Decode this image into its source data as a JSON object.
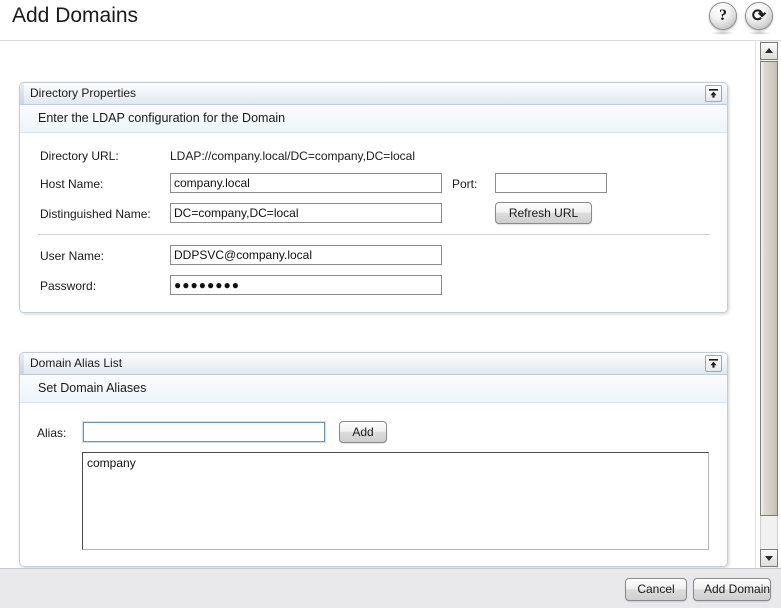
{
  "page": {
    "title": "Add Domains"
  },
  "header_icons": {
    "help": {
      "name": "help-icon",
      "glyph": "?"
    },
    "refresh": {
      "name": "refresh-icon",
      "glyph": "⟳"
    }
  },
  "directory_panel": {
    "title": "Directory Properties",
    "subtitle": "Enter the LDAP configuration for the Domain",
    "collapse_label": "",
    "fields": {
      "directory_url": {
        "label": "Directory URL:",
        "value": "LDAP://company.local/DC=company,DC=local"
      },
      "host_name": {
        "label": "Host Name:",
        "value": "company.local",
        "placeholder": ""
      },
      "port": {
        "label": "Port:",
        "value": "",
        "placeholder": ""
      },
      "distinguished_name": {
        "label": "Distinguished Name:",
        "value": "DC=company,DC=local",
        "placeholder": ""
      },
      "user_name": {
        "label": "User Name:",
        "value": "DDPSVC@company.local",
        "placeholder": ""
      },
      "password": {
        "label": "Password:",
        "value": "●●●●●●●●",
        "placeholder": ""
      }
    },
    "refresh_url_button": "Refresh URL"
  },
  "alias_panel": {
    "title": "Domain Alias List",
    "subtitle": "Set Domain Aliases",
    "alias_field": {
      "label": "Alias:",
      "value": "",
      "placeholder": ""
    },
    "add_button": "Add",
    "alias_list": [
      "company"
    ]
  },
  "bottom_bar": {
    "cancel": "Cancel",
    "add_domain": "Add Domain"
  },
  "colors": {
    "panel_border": "#c3ccd6",
    "header_gradient_top": "#fcfdfe",
    "header_gradient_bottom": "#dfe7f0",
    "page_background": "#ffffff",
    "toolbar_background": "#e9e9ec",
    "input_border": "#8c8c8c",
    "focus_border": "#6d93b8",
    "text": "#1a1a1a"
  }
}
